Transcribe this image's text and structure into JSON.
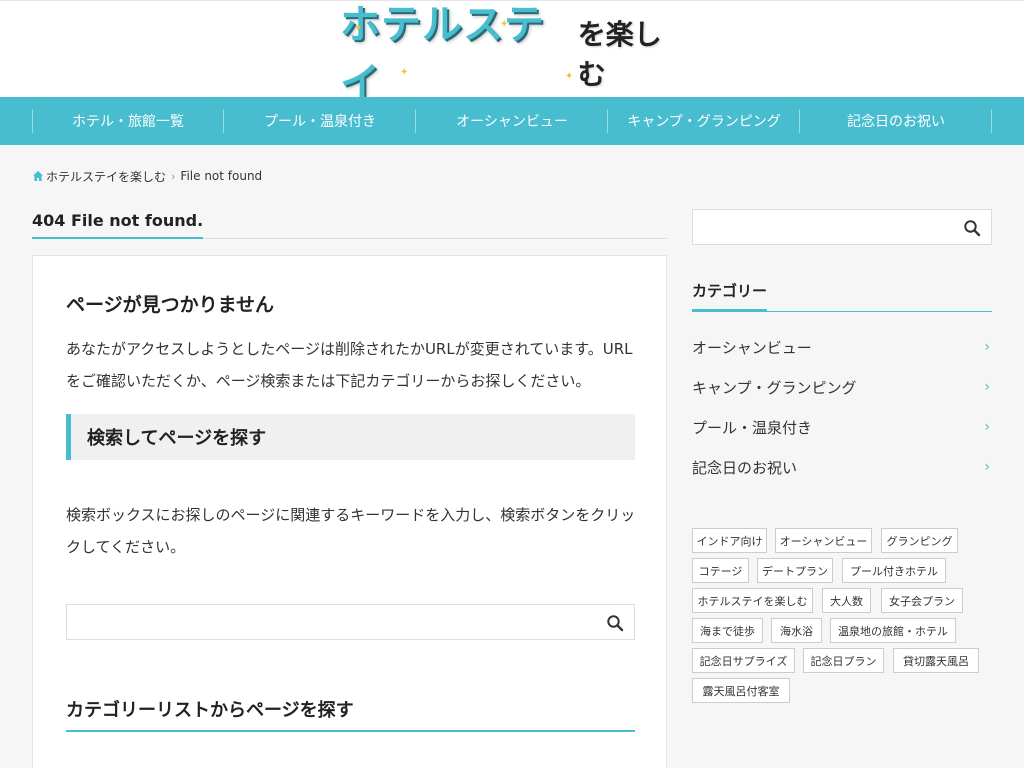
{
  "header": {
    "logo_main": "ホテルステイ",
    "logo_sub": "を楽しむ"
  },
  "nav": {
    "items": [
      {
        "label": "ホテル・旅館一覧"
      },
      {
        "label": "プール・温泉付き"
      },
      {
        "label": "オーシャンビュー"
      },
      {
        "label": "キャンプ・グランピング"
      },
      {
        "label": "記念日のお祝い"
      }
    ]
  },
  "breadcrumb": {
    "home": "ホテルステイを楽しむ",
    "current": "File not found"
  },
  "page": {
    "title": "404 File not found."
  },
  "content": {
    "title": "ページが見つかりません",
    "intro": "あなたがアクセスしようとしたページは削除されたかURLが変更されています。URLをご確認いただくか、ページ検索または下記カテゴリーからお探しください。",
    "search_heading": "検索してページを探す",
    "search_text": "検索ボックスにお探しのページに関連するキーワードを入力し、検索ボタンをクリックしてください。",
    "search_placeholder": "",
    "category_heading": "カテゴリーリストからページを探す"
  },
  "sidebar": {
    "search_placeholder": "",
    "category_title": "カテゴリー",
    "categories": [
      {
        "label": "オーシャンビュー"
      },
      {
        "label": "キャンプ・グランピング"
      },
      {
        "label": "プール・温泉付き"
      },
      {
        "label": "記念日のお祝い"
      }
    ],
    "tags": [
      {
        "label": "インドア向け"
      },
      {
        "label": "オーシャンビュー"
      },
      {
        "label": "グランピング"
      },
      {
        "label": "コテージ"
      },
      {
        "label": "デートプラン"
      },
      {
        "label": "プール付きホテル"
      },
      {
        "label": "ホテルステイを楽しむ"
      },
      {
        "label": "大人数"
      },
      {
        "label": "女子会プラン"
      },
      {
        "label": "海まで徒歩"
      },
      {
        "label": "海水浴"
      },
      {
        "label": "温泉地の旅館・ホテル"
      },
      {
        "label": "記念日サプライズ"
      },
      {
        "label": "記念日プラン"
      },
      {
        "label": "貸切露天風呂"
      },
      {
        "label": "露天風呂付客室"
      }
    ]
  },
  "colors": {
    "accent": "#48bdd0",
    "background": "#f6f6f6"
  }
}
